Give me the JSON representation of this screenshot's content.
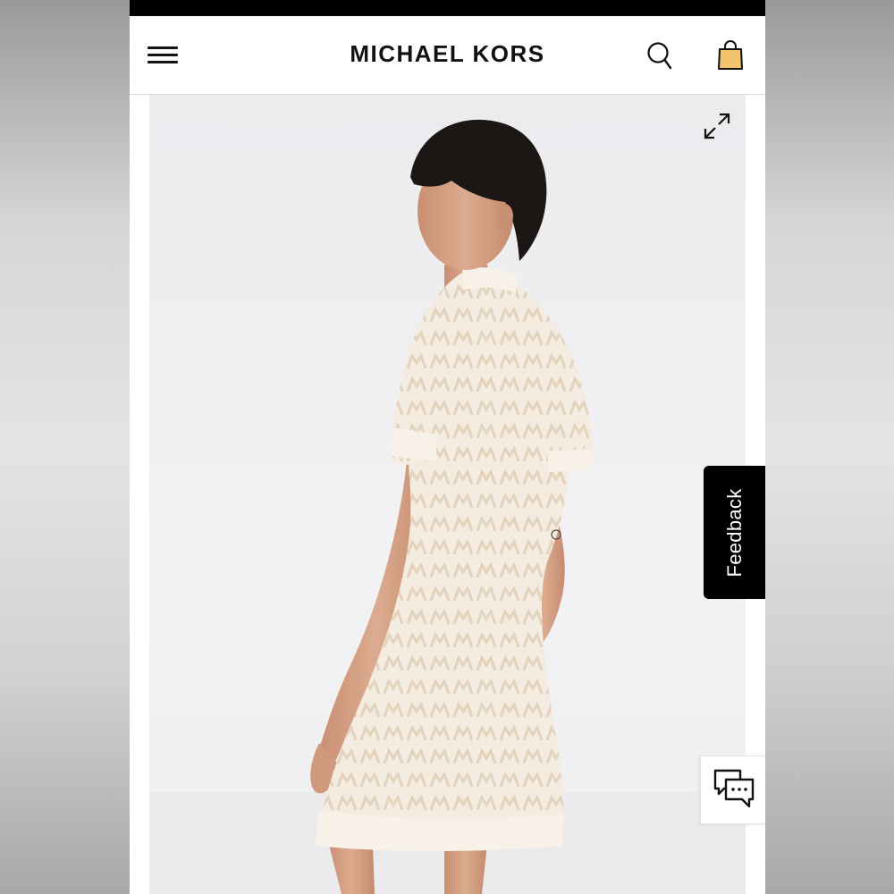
{
  "header": {
    "brand": "MICHAEL KORS",
    "icons": {
      "menu": "hamburger-menu-icon",
      "search": "search-icon",
      "bag": "shopping-bag-icon"
    }
  },
  "gallery": {
    "expand_icon": "expand-icon"
  },
  "feedback": {
    "label": "Feedback"
  },
  "chat": {
    "icon": "chat-icon"
  },
  "colors": {
    "bag_fill": "#f2c46b",
    "dress": "#f4ece0",
    "dress_pattern": "#e6d7c2",
    "hair": "#1c1715",
    "skin": "#d9a68a"
  }
}
